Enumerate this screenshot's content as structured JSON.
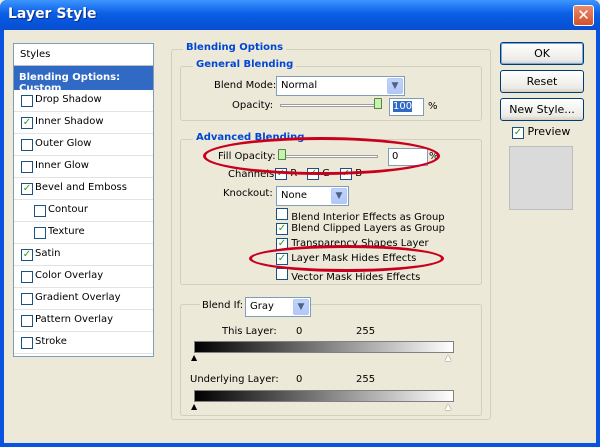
{
  "window": {
    "title": "Layer Style",
    "close_glyph": "✕"
  },
  "sidebar": {
    "header": "Styles",
    "active": "Blending Options: Custom",
    "items": [
      {
        "label": "Drop Shadow",
        "checked": false,
        "sub": false
      },
      {
        "label": "Inner Shadow",
        "checked": true,
        "sub": false
      },
      {
        "label": "Outer Glow",
        "checked": false,
        "sub": false
      },
      {
        "label": "Inner Glow",
        "checked": false,
        "sub": false
      },
      {
        "label": "Bevel and Emboss",
        "checked": true,
        "sub": false
      },
      {
        "label": "Contour",
        "checked": false,
        "sub": true
      },
      {
        "label": "Texture",
        "checked": false,
        "sub": true
      },
      {
        "label": "Satin",
        "checked": true,
        "sub": false
      },
      {
        "label": "Color Overlay",
        "checked": false,
        "sub": false
      },
      {
        "label": "Gradient Overlay",
        "checked": false,
        "sub": false
      },
      {
        "label": "Pattern Overlay",
        "checked": false,
        "sub": false
      },
      {
        "label": "Stroke",
        "checked": false,
        "sub": false
      }
    ]
  },
  "blending": {
    "title": "Blending Options",
    "general": {
      "title": "General Blending",
      "blend_mode_label": "Blend Mode:",
      "blend_mode": "Normal",
      "opacity_label": "Opacity:",
      "opacity": "100",
      "opacity_unit": "%",
      "opacity_level": 1.0
    },
    "advanced": {
      "title": "Advanced Blending",
      "fill_label": "Fill Opacity:",
      "fill": "0",
      "fill_unit": "%",
      "fill_level": 0.0,
      "channels_label": "Channels:",
      "ch_r": "R",
      "ch_g": "G",
      "ch_b": "B",
      "knockout_label": "Knockout:",
      "knockout": "None",
      "options": [
        {
          "label": "Blend Interior Effects as Group",
          "checked": false
        },
        {
          "label": "Blend Clipped Layers as Group",
          "checked": true
        },
        {
          "label": "Transparency Shapes Layer",
          "checked": true
        },
        {
          "label": "Layer Mask Hides Effects",
          "checked": true
        },
        {
          "label": "Vector Mask Hides Effects",
          "checked": false
        }
      ]
    },
    "blendif": {
      "label": "Blend If:",
      "value": "Gray",
      "this_layer": "This Layer:",
      "this_min": "0",
      "this_max": "255",
      "underlying": "Underlying Layer:",
      "under_min": "0",
      "under_max": "255"
    }
  },
  "buttons": {
    "ok": "OK",
    "reset": "Reset",
    "new_style": "New Style...",
    "preview": "Preview"
  },
  "check_glyph": "✓",
  "arrow_glyph": "▼"
}
